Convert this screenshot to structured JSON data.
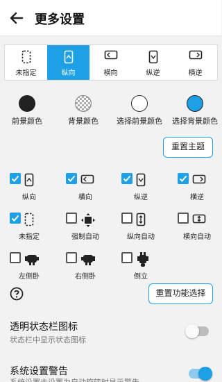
{
  "appbar": {
    "title": "更多设置",
    "back_icon": "arrow-left-icon"
  },
  "orientation_bar": {
    "items": [
      {
        "label": "未指定",
        "icon": "unspecified-icon",
        "selected": false
      },
      {
        "label": "纵向",
        "icon": "portrait-icon",
        "selected": true
      },
      {
        "label": "横向",
        "icon": "landscape-icon",
        "selected": false
      },
      {
        "label": "纵逆",
        "icon": "reverse-portrait-icon",
        "selected": false
      },
      {
        "label": "横逆",
        "icon": "reverse-landscape-icon",
        "selected": false
      }
    ],
    "accent": "#1ea0e6"
  },
  "colors": {
    "items": [
      {
        "label": "前景颜色",
        "color": "#222222"
      },
      {
        "label": "背景颜色",
        "color": "checkered"
      },
      {
        "label": "选择前景颜色",
        "color": "#ffffff"
      },
      {
        "label": "选择背景颜色",
        "color": "#1ea0e6"
      }
    ]
  },
  "reset_theme": {
    "label": "重置主题"
  },
  "features": [
    {
      "label": "纵向",
      "checked": true,
      "icon": "portrait-icon"
    },
    {
      "label": "横向",
      "checked": true,
      "icon": "landscape-icon"
    },
    {
      "label": "纵逆",
      "checked": true,
      "icon": "reverse-portrait-icon"
    },
    {
      "label": "横逆",
      "checked": true,
      "icon": "reverse-landscape-icon"
    },
    {
      "label": "未指定",
      "checked": true,
      "icon": "unspecified-icon"
    },
    {
      "label": "强制自动",
      "checked": false,
      "icon": "force-auto-icon"
    },
    {
      "label": "纵向自动",
      "checked": false,
      "icon": "portrait-auto-icon"
    },
    {
      "label": "横向自动",
      "checked": false,
      "icon": "landscape-auto-icon"
    },
    {
      "label": "左侧卧",
      "checked": false,
      "icon": "lie-left-icon"
    },
    {
      "label": "右侧卧",
      "checked": false,
      "icon": "lie-right-icon"
    },
    {
      "label": "倒立",
      "checked": false,
      "icon": "upside-down-icon"
    }
  ],
  "help": {
    "icon": "help-icon"
  },
  "reset_features": {
    "label": "重置功能选择"
  },
  "settings": [
    {
      "title": "透明状态栏图标",
      "subtitle": "状态栏中显示状态图标",
      "enabled": false
    },
    {
      "title": "系统设置警告",
      "subtitle": "系统设置未设置为自动旋转时显示警告",
      "enabled": true
    }
  ]
}
